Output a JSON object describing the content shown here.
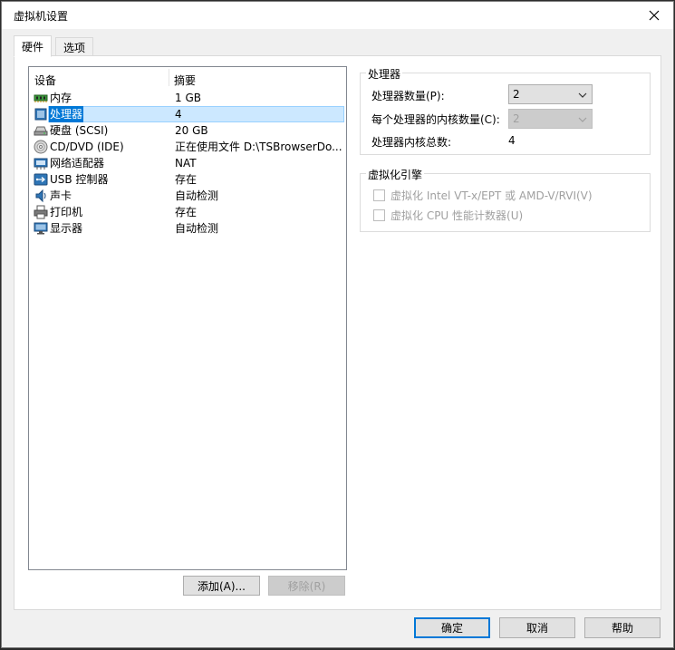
{
  "window": {
    "title": "虚拟机设置"
  },
  "tabs": [
    {
      "label": "硬件",
      "active": true
    },
    {
      "label": "选项",
      "active": false
    }
  ],
  "device_list": {
    "headers": {
      "device": "设备",
      "summary": "摘要"
    },
    "items": [
      {
        "icon": "memory-icon",
        "name": "内存",
        "summary": "1 GB",
        "selected": false
      },
      {
        "icon": "processor-icon",
        "name": "处理器",
        "summary": "4",
        "selected": true
      },
      {
        "icon": "hard-disk-icon",
        "name": "硬盘 (SCSI)",
        "summary": "20 GB",
        "selected": false
      },
      {
        "icon": "cd-dvd-icon",
        "name": "CD/DVD (IDE)",
        "summary": "正在使用文件 D:\\TSBrowserDo...",
        "selected": false
      },
      {
        "icon": "network-adapter-icon",
        "name": "网络适配器",
        "summary": "NAT",
        "selected": false
      },
      {
        "icon": "usb-icon",
        "name": "USB 控制器",
        "summary": "存在",
        "selected": false
      },
      {
        "icon": "sound-card-icon",
        "name": "声卡",
        "summary": "自动检测",
        "selected": false
      },
      {
        "icon": "printer-icon",
        "name": "打印机",
        "summary": "存在",
        "selected": false
      },
      {
        "icon": "display-icon",
        "name": "显示器",
        "summary": "自动检测",
        "selected": false
      }
    ],
    "add_button": "添加(A)...",
    "remove_button": "移除(R)"
  },
  "processor": {
    "group_title": "处理器",
    "count_label": "处理器数量(P):",
    "count_value": "2",
    "cores_label": "每个处理器的内核数量(C):",
    "cores_value": "2",
    "total_label": "处理器内核总数:",
    "total_value": "4"
  },
  "virtualization": {
    "group_title": "虚拟化引擎",
    "vtx_label": "虚拟化 Intel VT-x/EPT 或 AMD-V/RVI(V)",
    "vtx_checked": false,
    "cpu_counter_label": "虚拟化 CPU 性能计数器(U)",
    "cpu_counter_checked": false
  },
  "footer": {
    "ok": "确定",
    "cancel": "取消",
    "help": "帮助"
  }
}
